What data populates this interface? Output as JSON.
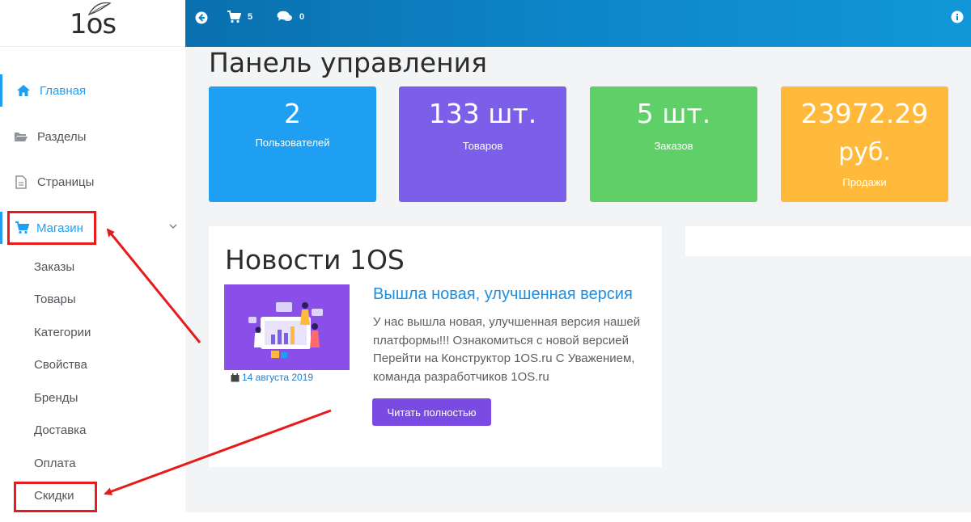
{
  "logo": {
    "text": "1os"
  },
  "sidebar": {
    "items": [
      {
        "label": "Главная",
        "icon": "home-icon"
      },
      {
        "label": "Разделы",
        "icon": "folder-open-icon"
      },
      {
        "label": "Страницы",
        "icon": "file-icon"
      },
      {
        "label": "Магазин",
        "icon": "cart-icon"
      }
    ],
    "shop_subitems": [
      "Заказы",
      "Товары",
      "Категории",
      "Свойства",
      "Бренды",
      "Доставка",
      "Оплата",
      "Скидки"
    ]
  },
  "topbar": {
    "cart_count": "5",
    "messages_count": "0"
  },
  "page_title": "Панель управления",
  "cards": [
    {
      "value": "2",
      "label": "Пользователей",
      "color": "#1e9ff2"
    },
    {
      "value": "133 шт.",
      "label": "Товаров",
      "color": "#7b5fe8"
    },
    {
      "value": "5 шт.",
      "label": "Заказов",
      "color": "#5fd068"
    },
    {
      "value_line1": "23972.29",
      "value_line2": "руб.",
      "label": "Продажи",
      "color": "#ffb93b"
    }
  ],
  "news": {
    "title": "Новости 1OS",
    "headline": "Вышла новая, улучшенная версия",
    "body": "У нас вышла новая, улучшенная версия нашей платформы!!! Ознакомиться с новой версией Перейти на Конструктор 1OS.ru С Уважением, команда разработчиков 1OS.ru",
    "date": "14 августа 2019",
    "button": "Читать полностью"
  },
  "colors": {
    "accent": "#1e9ff2",
    "highlight": "#e61b1b",
    "topbar": "#0d86c9"
  }
}
